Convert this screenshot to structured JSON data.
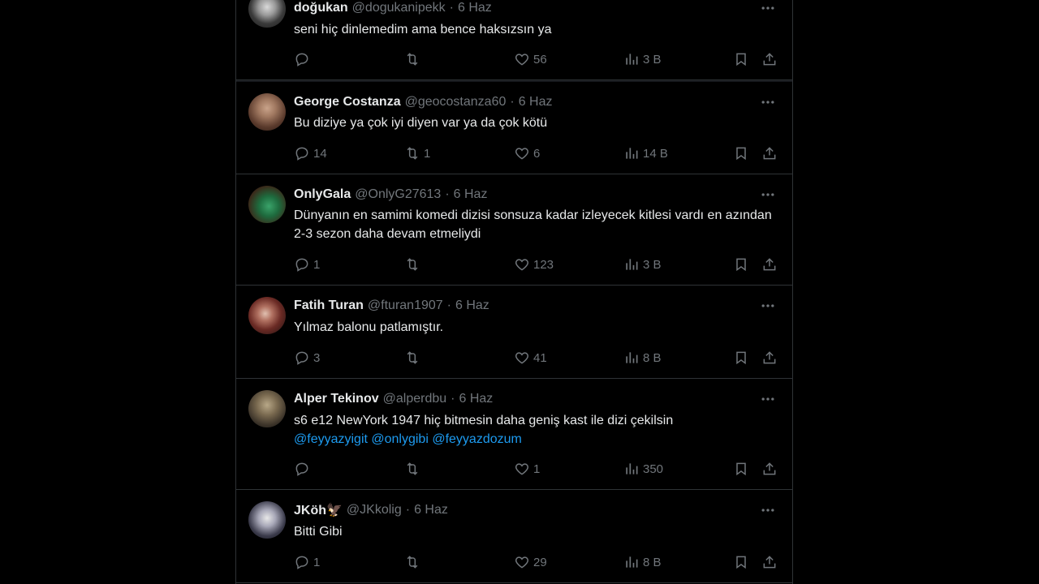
{
  "tweets": [
    {
      "name": "doğukan",
      "handle": "@dogukanipekk",
      "time": "6 Haz",
      "text": "seni hiç dinlemedim ama bence haksızsın ya",
      "mentions": "",
      "replies": "",
      "retweets": "",
      "likes": "56",
      "views": "3 B"
    },
    {
      "name": "George Costanza",
      "handle": "@geocostanza60",
      "time": "6 Haz",
      "text": "Bu diziye ya çok iyi diyen var ya da çok kötü",
      "mentions": "",
      "replies": "14",
      "retweets": "1",
      "likes": "6",
      "views": "14 B"
    },
    {
      "name": "OnlyGala",
      "handle": "@OnlyG27613",
      "time": "6 Haz",
      "text": "Dünyanın en samimi komedi dizisi sonsuza kadar izleyecek kitlesi vardı en azından 2-3 sezon daha devam etmeliydi",
      "mentions": "",
      "replies": "1",
      "retweets": "",
      "likes": "123",
      "views": "3 B"
    },
    {
      "name": "Fatih Turan",
      "handle": "@fturan1907",
      "time": "6 Haz",
      "text": "Yılmaz balonu patlamıştır.",
      "mentions": "",
      "replies": "3",
      "retweets": "",
      "likes": "41",
      "views": "8 B"
    },
    {
      "name": "Alper Tekinov",
      "handle": "@alperdbu",
      "time": "6 Haz",
      "text": "s6 e12 NewYork 1947 hiç bitmesin daha geniş kast ile dizi çekilsin",
      "mentions": "@feyyazyigit @onlygibi @feyyazdozum",
      "replies": "",
      "retweets": "",
      "likes": "1",
      "views": "350"
    },
    {
      "name": "JKöh🦅",
      "handle": "@JKkolig",
      "time": "6 Haz",
      "text": "Bitti Gibi",
      "mentions": "",
      "replies": "1",
      "retweets": "",
      "likes": "29",
      "views": "8 B"
    }
  ],
  "separator": "·",
  "icons": {
    "more": "more-horizontal-icon",
    "reply": "reply-icon",
    "retweet": "retweet-icon",
    "like": "heart-icon",
    "views": "views-icon",
    "bookmark": "bookmark-icon",
    "share": "share-icon"
  },
  "colors": {
    "background": "#000000",
    "text": "#e7e9ea",
    "muted": "#71767b",
    "link": "#1d9bf0",
    "border": "#2f3336"
  }
}
